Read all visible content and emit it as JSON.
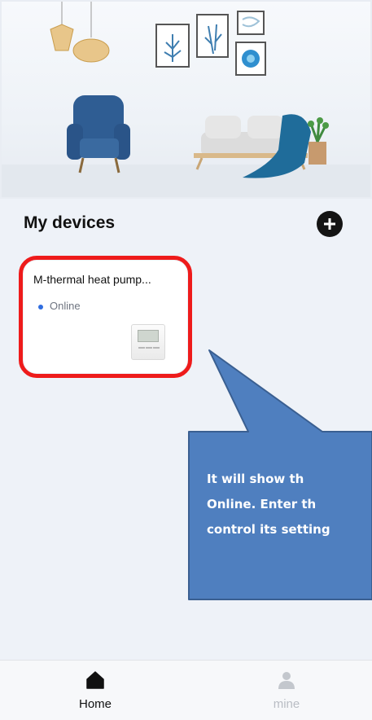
{
  "header": {
    "section_title": "My devices"
  },
  "devices": [
    {
      "name": "M-thermal heat pump...",
      "status": "Online",
      "status_color": "#2f6de0"
    }
  ],
  "callout": {
    "lines": [
      "It will show th",
      "Online. Enter th",
      "control its setting"
    ],
    "fill_color": "#4f7fbf",
    "highlight_color": "#ee1b1b"
  },
  "bottom_nav": [
    {
      "label": "Home",
      "icon": "home-icon",
      "active": true
    },
    {
      "label": "mine",
      "icon": "user-icon",
      "active": false
    }
  ]
}
